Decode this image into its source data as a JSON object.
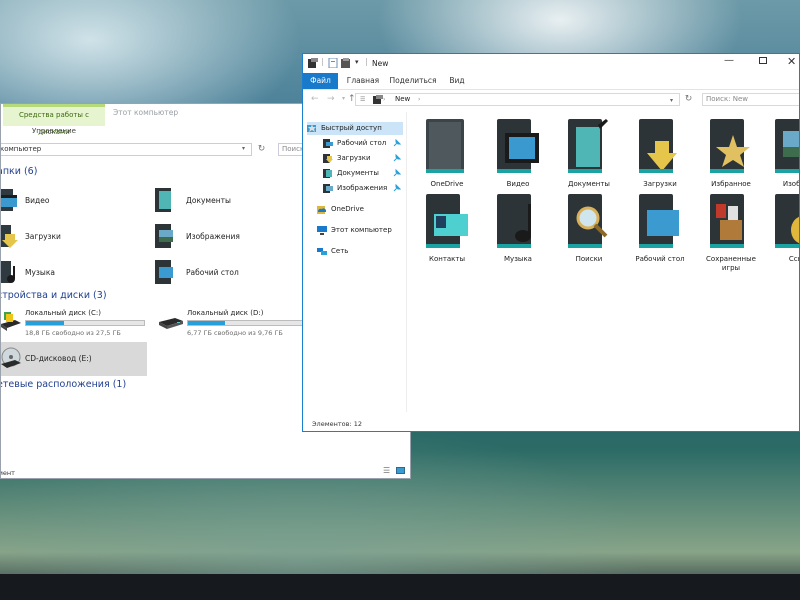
{
  "left_window": {
    "tool_tab": "Средства работы с дисками",
    "title": "Этот компьютер",
    "manage_tab": "Управление",
    "address": "компьютер",
    "search_placeholder": "Поиск",
    "folders_header": "апки (6)",
    "folders": [
      {
        "label": "Видео",
        "icon": "video-folder-icon"
      },
      {
        "label": "Документы",
        "icon": "documents-folder-icon"
      },
      {
        "label": "Загрузки",
        "icon": "downloads-folder-icon"
      },
      {
        "label": "Изображения",
        "icon": "pictures-folder-icon"
      },
      {
        "label": "Музыка",
        "icon": "music-folder-icon"
      },
      {
        "label": "Рабочий стол",
        "icon": "desktop-folder-icon"
      }
    ],
    "devices_header": "стройства и диски (3)",
    "drives": [
      {
        "name": "Локальный диск (C:)",
        "free": "18,8 ГБ свободно из 27,5 ГБ",
        "used_fraction": 0.32
      },
      {
        "name": "Локальный диск (D:)",
        "free": "6,77 ГБ свободно из 9,76 ГБ",
        "used_fraction": 0.31
      }
    ],
    "cd_drive": "CD-дисковод (E:)",
    "network_header": "етевые расположения (1)",
    "status": "мент"
  },
  "right_window": {
    "title": "New",
    "tabs": [
      "Файл",
      "Главная",
      "Поделиться",
      "Вид"
    ],
    "address_crumb": "New",
    "search_placeholder": "Поиск: New",
    "sidebar": [
      {
        "label": "Быстрый доступ",
        "icon": "star-icon"
      },
      {
        "label": "Рабочий стол",
        "icon": "desktop-icon"
      },
      {
        "label": "Загрузки",
        "icon": "downloads-icon"
      },
      {
        "label": "Документы",
        "icon": "documents-icon"
      },
      {
        "label": "Изображения",
        "icon": "pictures-icon"
      },
      {
        "label": "OneDrive",
        "icon": "onedrive-icon"
      },
      {
        "label": "Этот компьютер",
        "icon": "computer-icon"
      },
      {
        "label": "Сеть",
        "icon": "network-icon"
      }
    ],
    "items": [
      {
        "label": "OneDrive",
        "icon": "onedrive-folder-icon"
      },
      {
        "label": "Видео",
        "icon": "video-folder-icon"
      },
      {
        "label": "Документы",
        "icon": "documents-folder-icon"
      },
      {
        "label": "Загрузки",
        "icon": "downloads-folder-icon"
      },
      {
        "label": "Избранное",
        "icon": "favorites-folder-icon"
      },
      {
        "label": "Изобра",
        "icon": "pictures-folder-icon"
      },
      {
        "label": "Контакты",
        "icon": "contacts-folder-icon"
      },
      {
        "label": "Музыка",
        "icon": "music-folder-icon"
      },
      {
        "label": "Поиски",
        "icon": "searches-folder-icon"
      },
      {
        "label": "Рабочий стол",
        "icon": "desktop-folder-icon"
      },
      {
        "label": "Сохраненные игры",
        "icon": "saved-games-folder-icon"
      },
      {
        "label": "Ссы",
        "icon": "links-folder-icon"
      }
    ],
    "status": "Элементов: 12"
  },
  "colors": {
    "accent": "#1979ca",
    "header_blue": "#1f3f8f",
    "drive_bar": "#26a0da",
    "tool_tab": "#e6f4cf"
  }
}
